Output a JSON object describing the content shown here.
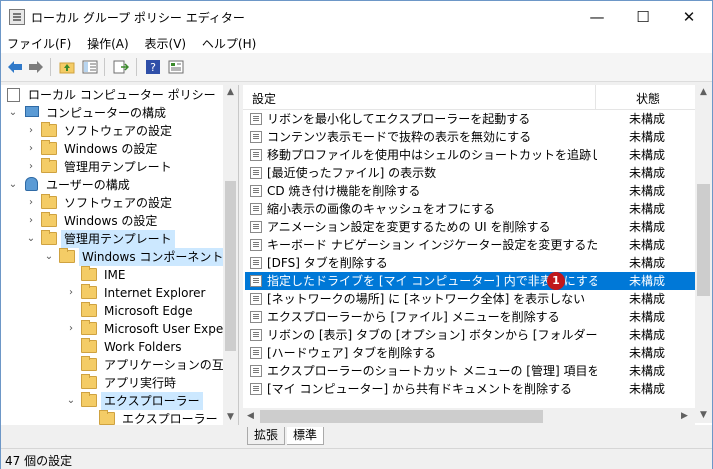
{
  "window": {
    "title": "ローカル グループ ポリシー エディター"
  },
  "caption_buttons": {
    "minimize": "—",
    "maximize": "☐",
    "close": "✕"
  },
  "menu": [
    "ファイル(F)",
    "操作(A)",
    "表示(V)",
    "ヘルプ(H)"
  ],
  "toolbar": {
    "icons": [
      "back-arrow-icon",
      "forward-arrow-icon",
      "up-folder-icon",
      "show-hide-tree-icon",
      "export-list-icon",
      "help-icon",
      "properties-icon"
    ]
  },
  "tree": [
    {
      "label": "ローカル コンピューター ポリシー",
      "icon": "policy-icon",
      "twisty": ""
    },
    {
      "label": "コンピューターの構成",
      "icon": "computer-icon",
      "twisty": "⌄"
    },
    {
      "label": "ソフトウェアの設定",
      "icon": "folder-icon",
      "twisty": "›"
    },
    {
      "label": "Windows の設定",
      "icon": "folder-icon",
      "twisty": "›"
    },
    {
      "label": "管理用テンプレート",
      "icon": "folder-icon",
      "twisty": "›"
    },
    {
      "label": "ユーザーの構成",
      "icon": "user-icon",
      "twisty": "⌄"
    },
    {
      "label": "ソフトウェアの設定",
      "icon": "folder-icon",
      "twisty": "›"
    },
    {
      "label": "Windows の設定",
      "icon": "folder-icon",
      "twisty": "›"
    },
    {
      "label": "管理用テンプレート",
      "icon": "folder-icon",
      "twisty": "⌄"
    },
    {
      "label": "Windows コンポーネント",
      "icon": "folder-open-icon",
      "twisty": "⌄"
    },
    {
      "label": "IME",
      "icon": "folder-icon",
      "twisty": ""
    },
    {
      "label": "Internet Explorer",
      "icon": "folder-icon",
      "twisty": "›"
    },
    {
      "label": "Microsoft Edge",
      "icon": "folder-icon",
      "twisty": ""
    },
    {
      "label": "Microsoft User Experie",
      "icon": "folder-icon",
      "twisty": "›"
    },
    {
      "label": "Work Folders",
      "icon": "folder-icon",
      "twisty": ""
    },
    {
      "label": "アプリケーションの互換性",
      "icon": "folder-icon",
      "twisty": ""
    },
    {
      "label": "アプリ実行時",
      "icon": "folder-icon",
      "twisty": ""
    },
    {
      "label": "エクスプローラー",
      "icon": "folder-open-icon",
      "twisty": "⌄"
    },
    {
      "label": "エクスプローラー フレー",
      "icon": "folder-icon",
      "twisty": ""
    }
  ],
  "list": {
    "columns": {
      "setting": "設定",
      "state": "状態"
    },
    "rows": [
      {
        "name": "リボンを最小化してエクスプローラーを起動する",
        "state": "未構成"
      },
      {
        "name": "コンテンツ表示モードで抜粋の表示を無効にする",
        "state": "未構成"
      },
      {
        "name": "移動プロファイルを使用中はシェルのショートカットを追跡しない",
        "state": "未構成"
      },
      {
        "name": "[最近使ったファイル] の表示数",
        "state": "未構成"
      },
      {
        "name": "CD 焼き付け機能を削除する",
        "state": "未構成"
      },
      {
        "name": "縮小表示の画像のキャッシュをオフにする",
        "state": "未構成"
      },
      {
        "name": "アニメーション設定を変更するための UI を削除する",
        "state": "未構成"
      },
      {
        "name": "キーボード ナビゲーション インジケーター設定を変更するための UI を削",
        "state": "未構成"
      },
      {
        "name": "[DFS] タブを削除する",
        "state": "未構成"
      },
      {
        "name": "指定したドライブを [マイ コンピューター] 内で非表示にする",
        "state": "未構成"
      },
      {
        "name": "[ネットワークの場所] に [ネットワーク全体] を表示しない",
        "state": "未構成"
      },
      {
        "name": "エクスプローラーから [ファイル] メニューを削除する",
        "state": "未構成"
      },
      {
        "name": "リボンの [表示] タブの [オプション] ボタンから [フォルダー オプション] ...",
        "state": "未構成"
      },
      {
        "name": "[ハードウェア] タブを削除する",
        "state": "未構成"
      },
      {
        "name": "エクスプローラーのショートカット メニューの [管理] 項目を非表示にする",
        "state": "未構成"
      },
      {
        "name": "[マイ コンピューター] から共有ドキュメントを削除する",
        "state": "未構成"
      }
    ],
    "selected_badge": "1"
  },
  "tabs": [
    "拡張",
    "標準"
  ],
  "status": "47 個の設定"
}
